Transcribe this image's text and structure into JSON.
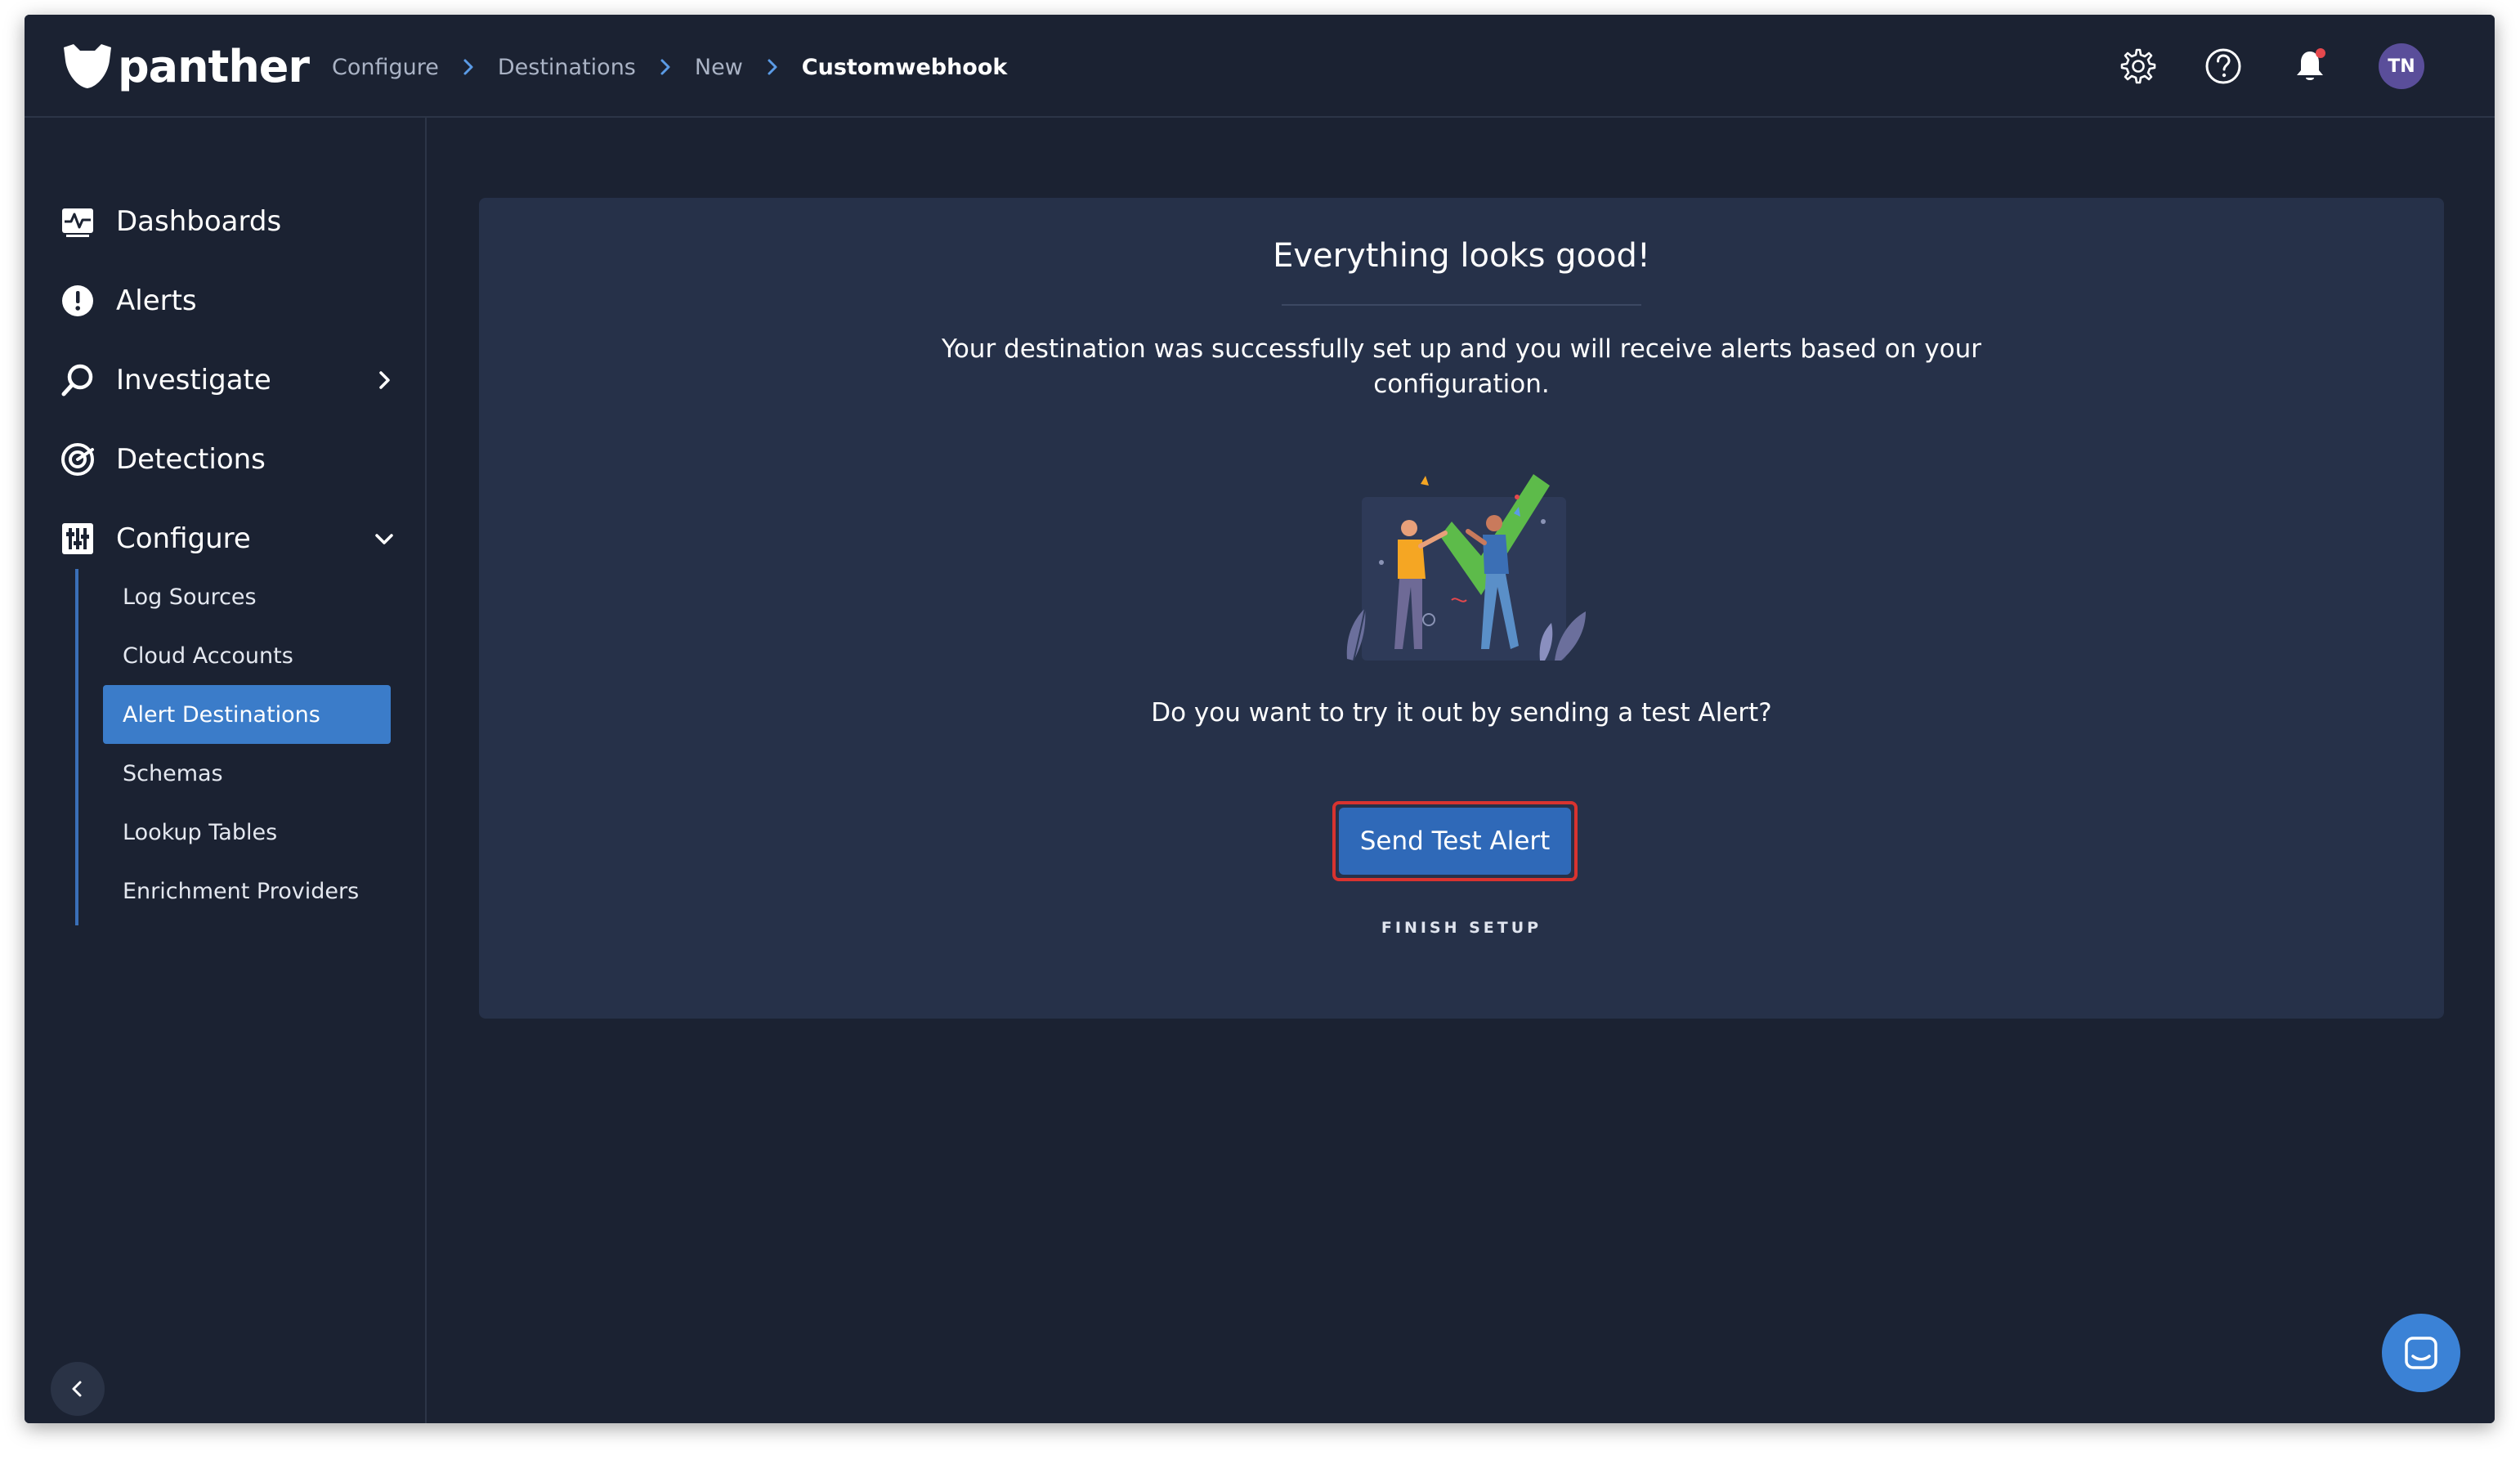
{
  "app": {
    "logo_text": "panther"
  },
  "breadcrumb": {
    "items": [
      "Configure",
      "Destinations",
      "New"
    ],
    "current": "Customwebhook"
  },
  "header": {
    "icons": [
      "gear-icon",
      "help-icon",
      "bell-icon"
    ],
    "avatar_initials": "TN",
    "notification_dot_color": "#e5484d"
  },
  "sidebar": {
    "items": [
      {
        "label": "Dashboards",
        "icon": "dashboard-icon"
      },
      {
        "label": "Alerts",
        "icon": "alert-icon"
      },
      {
        "label": "Investigate",
        "icon": "search-icon",
        "chevron": "right"
      },
      {
        "label": "Detections",
        "icon": "detections-icon"
      },
      {
        "label": "Configure",
        "icon": "configure-icon",
        "chevron": "down"
      }
    ],
    "subitems": [
      {
        "label": "Log Sources",
        "active": false
      },
      {
        "label": "Cloud Accounts",
        "active": false
      },
      {
        "label": "Alert Destinations",
        "active": true
      },
      {
        "label": "Schemas",
        "active": false
      },
      {
        "label": "Lookup Tables",
        "active": false
      },
      {
        "label": "Enrichment Providers",
        "active": false
      }
    ]
  },
  "main": {
    "title": "Everything looks good!",
    "description": "Your destination was successfully set up and you will receive alerts based on your configuration.",
    "question": "Do you want to try it out by sending a test Alert?",
    "send_button": "Send Test Alert",
    "finish_link": "FINISH SETUP"
  },
  "colors": {
    "background": "#1b2232",
    "card": "#263149",
    "accent": "#3b7cc9",
    "button": "#2f69b8",
    "highlight_border": "#d8332f"
  }
}
